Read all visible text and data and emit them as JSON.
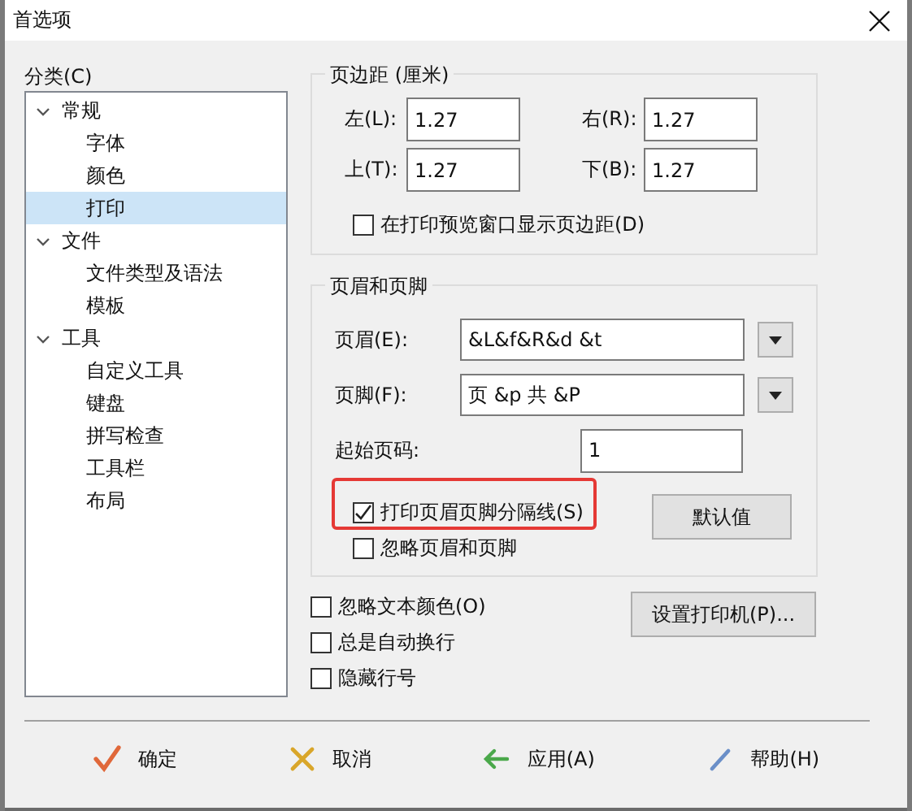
{
  "window": {
    "title": "首选项"
  },
  "category": {
    "label": "分类(C)",
    "tree": [
      {
        "label": "常规",
        "expanded": true,
        "selected": false,
        "children": [
          {
            "label": "字体",
            "selected": false
          },
          {
            "label": "颜色",
            "selected": false
          },
          {
            "label": "打印",
            "selected": true
          }
        ]
      },
      {
        "label": "文件",
        "expanded": true,
        "selected": false,
        "children": [
          {
            "label": "文件类型及语法",
            "selected": false
          },
          {
            "label": "模板",
            "selected": false
          }
        ]
      },
      {
        "label": "工具",
        "expanded": true,
        "selected": false,
        "children": [
          {
            "label": "自定义工具",
            "selected": false
          },
          {
            "label": "键盘",
            "selected": false
          },
          {
            "label": "拼写检查",
            "selected": false
          },
          {
            "label": "工具栏",
            "selected": false
          },
          {
            "label": "布局",
            "selected": false
          }
        ]
      }
    ]
  },
  "margins": {
    "title": "页边距 (厘米)",
    "fields": [
      {
        "label": "左(L):",
        "value": "1.27"
      },
      {
        "label": "右(R):",
        "value": "1.27"
      },
      {
        "label": "上(T):",
        "value": "1.27"
      },
      {
        "label": "下(B):",
        "value": "1.27"
      }
    ],
    "preview_checkbox": {
      "label": "在打印预览窗口显示页边距(D)",
      "checked": false
    }
  },
  "header_footer": {
    "title": "页眉和页脚",
    "header": {
      "label": "页眉(E):",
      "value": "&L&f&R&d &t"
    },
    "footer": {
      "label": "页脚(F):",
      "value": "页 &p 共 &P"
    },
    "start_page": {
      "label": "起始页码:",
      "value": "1"
    },
    "checkboxes": [
      {
        "label": "打印页眉页脚分隔线(S)",
        "checked": true,
        "highlighted": true
      },
      {
        "label": "忽略页眉和页脚",
        "checked": false,
        "highlighted": false
      }
    ],
    "default_button": "默认值"
  },
  "options": [
    {
      "label": "忽略文本颜色(O)",
      "checked": false
    },
    {
      "label": "总是自动换行",
      "checked": false
    },
    {
      "label": "隐藏行号",
      "checked": false
    }
  ],
  "printer_button": "设置打印机(P)...",
  "buttons": [
    {
      "label": "确定",
      "kind": "ok"
    },
    {
      "label": "取消",
      "kind": "cancel"
    },
    {
      "label": "应用(A)",
      "kind": "apply"
    },
    {
      "label": "帮助(H)",
      "kind": "help"
    }
  ]
}
